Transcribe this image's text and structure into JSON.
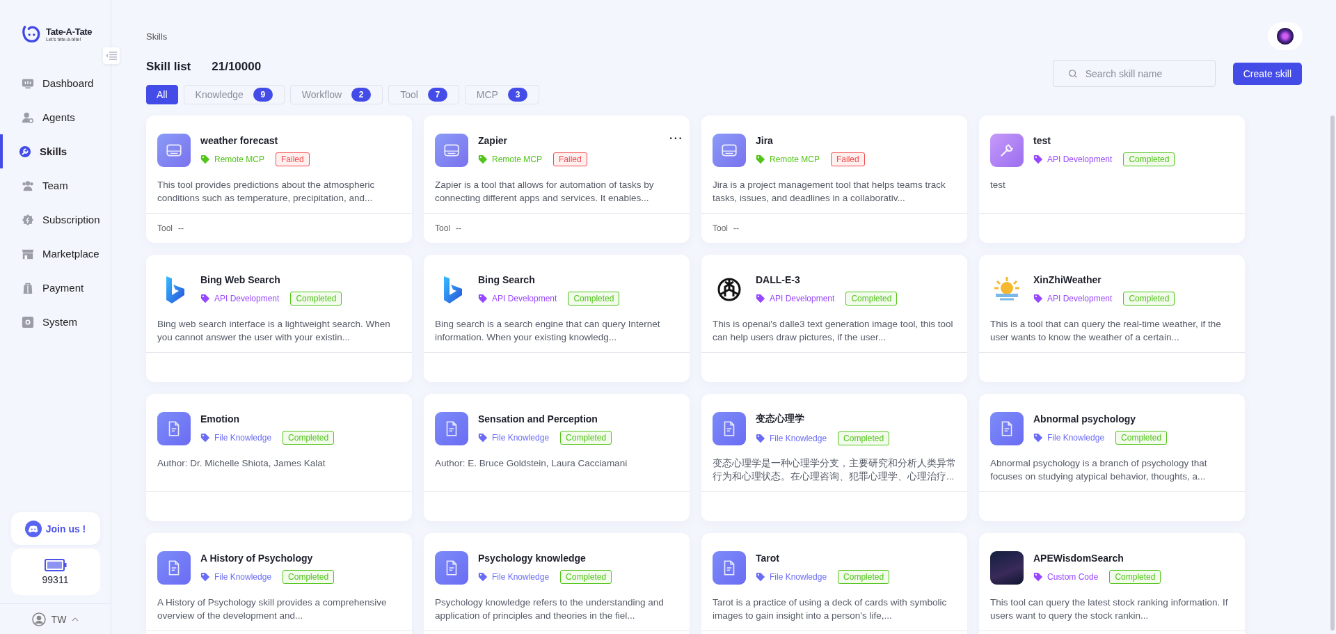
{
  "sidebar": {
    "logo": {
      "name": "Tate-A-Tate",
      "tagline": "Let's tête-à-tête!"
    },
    "items": [
      {
        "label": "Dashboard",
        "selected": false
      },
      {
        "label": "Agents",
        "selected": false
      },
      {
        "label": "Skills",
        "selected": true
      },
      {
        "label": "Team",
        "selected": false
      },
      {
        "label": "Subscription",
        "selected": false
      },
      {
        "label": "Marketplace",
        "selected": false
      },
      {
        "label": "Payment",
        "selected": false
      },
      {
        "label": "System",
        "selected": false
      }
    ],
    "join": "Join us !",
    "credits": "99311",
    "user": "TW"
  },
  "breadcrumb": "Skills",
  "header": {
    "title": "Skill list",
    "count": "21/10000"
  },
  "filters": [
    {
      "label": "All",
      "selected": true
    },
    {
      "label": "Knowledge",
      "count": "9",
      "selected": false
    },
    {
      "label": "Workflow",
      "count": "2",
      "selected": false
    },
    {
      "label": "Tool",
      "count": "7",
      "selected": false
    },
    {
      "label": "MCP",
      "count": "3",
      "selected": false
    }
  ],
  "search": {
    "placeholder": "Search skill name"
  },
  "create_button": "Create skill",
  "cards": [
    {
      "kind": "mcp",
      "name": "weather forecast",
      "tag": {
        "label": "Remote MCP",
        "color": "#52c41a"
      },
      "status": {
        "label": "Failed",
        "failed": true
      },
      "description": "This tool provides predictions about the atmospheric conditions such as temperature, precipitation, and...",
      "footer": "Tool",
      "footer_value": "--"
    },
    {
      "kind": "mcp",
      "name": "Zapier",
      "menu": "⋯",
      "tag": {
        "label": "Remote MCP",
        "color": "#52c41a"
      },
      "status": {
        "label": "Failed",
        "failed": true
      },
      "description": "Zapier is a tool that allows for automation of tasks by connecting different apps and services. It enables...",
      "footer": "Tool",
      "footer_value": "--"
    },
    {
      "kind": "mcp",
      "name": "Jira",
      "tag": {
        "label": "Remote MCP",
        "color": "#52c41a"
      },
      "status": {
        "label": "Failed",
        "failed": true
      },
      "description": "Jira is a project management tool that helps teams track tasks, issues, and deadlines in a collaborativ...",
      "footer": "Tool",
      "footer_value": "--"
    },
    {
      "kind": "wrench",
      "name": "test",
      "tag": {
        "label": "API Development",
        "color": "#9747ff"
      },
      "status": {
        "label": "Completed",
        "failed": false
      },
      "description": "test"
    },
    {
      "kind": "bing",
      "name": "Bing Web Search",
      "tag": {
        "label": "API Development",
        "color": "#9747ff"
      },
      "status": {
        "label": "Completed",
        "failed": false
      },
      "description": "Bing web search interface is a lightweight search. When you cannot answer the user with your existin..."
    },
    {
      "kind": "bing",
      "name": "Bing Search",
      "tag": {
        "label": "API Development",
        "color": "#9747ff"
      },
      "status": {
        "label": "Completed",
        "failed": false
      },
      "description": "Bing search is a search engine that can query Internet information. When your existing knowledg..."
    },
    {
      "kind": "knot",
      "name": "DALL-E-3",
      "tag": {
        "label": "API Development",
        "color": "#9747ff"
      },
      "status": {
        "label": "Completed",
        "failed": false
      },
      "description": "This is openai's dalle3 text generation image tool, this tool can help users draw pictures, if the user..."
    },
    {
      "kind": "sun",
      "name": "XinZhiWeather",
      "tag": {
        "label": "API Development",
        "color": "#9747ff"
      },
      "status": {
        "label": "Completed",
        "failed": false
      },
      "description": "This is a tool that can query the real-time weather, if the user wants to know the weather of a certain..."
    },
    {
      "kind": "doc",
      "name": "Emotion",
      "tag": {
        "label": "File Knowledge",
        "color": "#6b6cf6"
      },
      "status": {
        "label": "Completed",
        "failed": false
      },
      "description": "Author: Dr. Michelle Shiota, James Kalat"
    },
    {
      "kind": "doc",
      "name": "Sensation and Perception",
      "tag": {
        "label": "File Knowledge",
        "color": "#6b6cf6"
      },
      "status": {
        "label": "Completed",
        "failed": false
      },
      "description": "Author: E. Bruce Goldstein, Laura Cacciamani"
    },
    {
      "kind": "doc",
      "name": "变态心理学",
      "tag": {
        "label": "File Knowledge",
        "color": "#6b6cf6"
      },
      "status": {
        "label": "Completed",
        "failed": false
      },
      "description": "变态心理学是一种心理学分支，主要研究和分析人类异常行为和心理状态。在心理咨询、犯罪心理学、心理治疗..."
    },
    {
      "kind": "doc",
      "name": "Abnormal psychology",
      "tag": {
        "label": "File Knowledge",
        "color": "#6b6cf6"
      },
      "status": {
        "label": "Completed",
        "failed": false
      },
      "description": "Abnormal psychology is a branch of psychology that focuses on studying atypical behavior, thoughts, a..."
    },
    {
      "kind": "doc",
      "name": "A History of Psychology",
      "tag": {
        "label": "File Knowledge",
        "color": "#6b6cf6"
      },
      "status": {
        "label": "Completed",
        "failed": false
      },
      "description": "A History of Psychology skill provides a comprehensive overview of the development and..."
    },
    {
      "kind": "doc",
      "name": "Psychology knowledge",
      "tag": {
        "label": "File Knowledge",
        "color": "#6b6cf6"
      },
      "status": {
        "label": "Completed",
        "failed": false
      },
      "description": "Psychology knowledge refers to the understanding and application of principles and theories in the fiel..."
    },
    {
      "kind": "doc",
      "name": "Tarot",
      "tag": {
        "label": "File Knowledge",
        "color": "#6b6cf6"
      },
      "status": {
        "label": "Completed",
        "failed": false
      },
      "description": "Tarot is a practice of using a deck of cards with symbolic images to gain insight into a person's life,..."
    },
    {
      "kind": "photo",
      "name": "APEWisdomSearch",
      "tag": {
        "label": "Custom Code",
        "color": "#9747ff"
      },
      "status": {
        "label": "Completed",
        "failed": false
      },
      "description": "This tool can query the latest stock ranking information. If users want to query the stock rankin..."
    }
  ]
}
